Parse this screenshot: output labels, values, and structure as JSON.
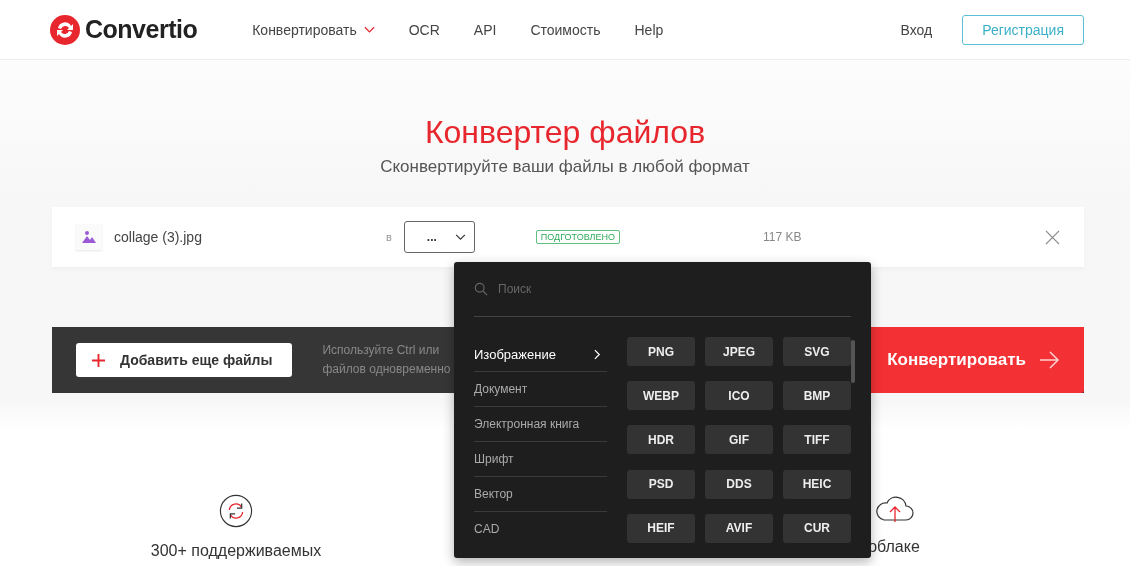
{
  "header": {
    "logo": "Convertio",
    "nav": [
      {
        "label": "Конвертировать",
        "dropdown": true
      },
      {
        "label": "OCR",
        "dropdown": false
      },
      {
        "label": "API",
        "dropdown": false
      },
      {
        "label": "Стоимость",
        "dropdown": false
      },
      {
        "label": "Help",
        "dropdown": false
      }
    ],
    "login": "Вход",
    "signup": "Регистрация"
  },
  "hero": {
    "title": "Конвертер файлов",
    "subtitle": "Сконвертируйте ваши файлы в любой формат"
  },
  "file": {
    "name": "collage (3).jpg",
    "to_label": "в",
    "format": "...",
    "status": "ПОДГОТОВЛЕНО",
    "size": "117 KB"
  },
  "actions": {
    "add_button": "Добавить еще файлы",
    "hint_lines": [
      "Используйте Ctrl или",
      "файлов одновременно"
    ],
    "convert_button": "Конвертировать"
  },
  "format_menu": {
    "search": {
      "placeholder": "Поиск"
    },
    "categories": [
      {
        "label": "Изображение",
        "selected": true
      },
      {
        "label": "Документ",
        "selected": false
      },
      {
        "label": "Электронная книга",
        "selected": false
      },
      {
        "label": "Шрифт",
        "selected": false
      },
      {
        "label": "Вектор",
        "selected": false
      },
      {
        "label": "CAD",
        "selected": false
      }
    ],
    "formats": [
      "PNG",
      "JPEG",
      "SVG",
      "WEBP",
      "ICO",
      "BMP",
      "HDR",
      "GIF",
      "TIFF",
      "PSD",
      "DDS",
      "HEIC",
      "HEIF",
      "AVIF",
      "CUR"
    ]
  },
  "features": [
    {
      "kind": "formats",
      "label": "300+ поддерживаемых"
    },
    {
      "kind": "hidden"
    },
    {
      "kind": "cloud",
      "label": "облаке"
    }
  ]
}
